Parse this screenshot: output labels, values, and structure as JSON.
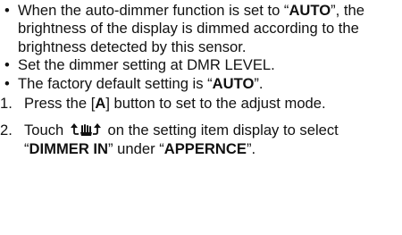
{
  "bullets": {
    "mark": "•",
    "item1": {
      "pre": "When the auto-dimmer function is set to “",
      "bold": "AUTO",
      "post": "”, the brightness of the display is dimmed according to the brightness detected by this sensor."
    },
    "item2": {
      "text": "Set the dimmer setting at DMR LEVEL."
    },
    "item3": {
      "pre": "The factory default setting is “",
      "bold": "AUTO",
      "post": "”."
    }
  },
  "steps": {
    "step1": {
      "number": "1.",
      "pre": "Press the [",
      "bold": "A",
      "post": "] button to set to the adjust mode."
    },
    "step2": {
      "number": "2.",
      "pre": "Touch ",
      "icon": "touch-swipe-icon",
      "mid": " on the setting item display to select “",
      "bold1": "DIMMER IN",
      "mid2": "” under “",
      "bold2": "APPERNCE",
      "post": "”."
    }
  }
}
